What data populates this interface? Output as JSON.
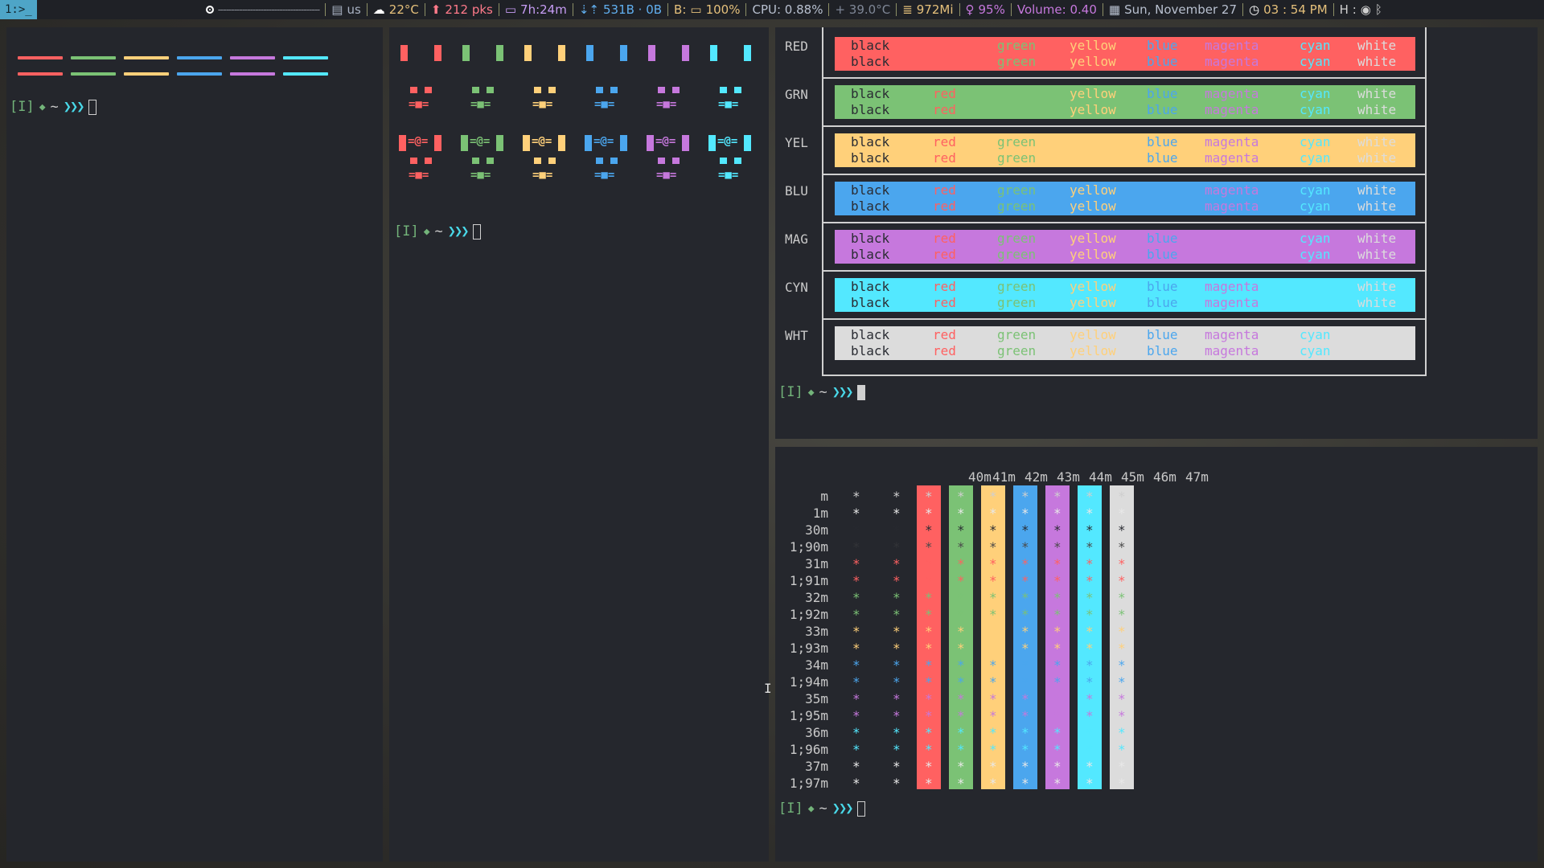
{
  "topbar": {
    "workspace": "1:>_",
    "dashes": "--------------------------------------",
    "keyboard": "us",
    "weather": "22°C",
    "packages": "212 pks",
    "uptime": "7h:24m",
    "net": "531B · 0B",
    "battery": "100%",
    "battery_prefix": "B:",
    "cpu": "CPU: 0.88%",
    "temp": "+ 39.0°C",
    "memory": "972Mi",
    "brightness": "95%",
    "volume": "Volume: 0.40",
    "date": "Sun, November 27",
    "time": "03 : 54 PM",
    "host": "H :"
  },
  "colors": {
    "red": "#ff6161",
    "green": "#7bc275",
    "yellow": "#ffd07a",
    "blue": "#4ba6ee",
    "magenta": "#c678dd",
    "cyan": "#53e8ff",
    "white": "#dcdcdc",
    "black": "#2a2c33"
  },
  "prompt": {
    "mode": "[I]",
    "diamond": "◆",
    "tilde": "~",
    "arrows": "❯❯❯"
  },
  "pane2": {
    "face": "=@=",
    "eyes": "▀ ▀",
    "mouth": "=■="
  },
  "table": {
    "rows": [
      "RED",
      "GRN",
      "YEL",
      "BLU",
      "MAG",
      "CYN",
      "WHT"
    ],
    "words": [
      "black",
      "red",
      "green",
      "yellow",
      "blue",
      "magenta",
      "cyan",
      "white"
    ]
  },
  "chart": {
    "columns": [
      "40m",
      "41m",
      "42m",
      "43m",
      "44m",
      "45m",
      "46m",
      "47m"
    ],
    "rows": [
      "m",
      "1m",
      "30m",
      "1;90m",
      "31m",
      "1;91m",
      "32m",
      "1;92m",
      "33m",
      "1;93m",
      "34m",
      "1;94m",
      "35m",
      "1;95m",
      "36m",
      "1;96m",
      "37m",
      "1;97m"
    ],
    "glyph": "*"
  }
}
